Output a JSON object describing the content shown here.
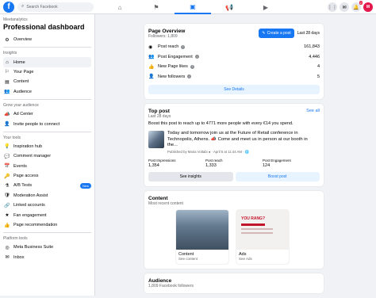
{
  "topbar": {
    "logo": "f",
    "search_placeholder": "Search Facebook",
    "nav_icons": [
      "home-icon",
      "flag-icon",
      "pages-icon",
      "megaphone-icon",
      "watch-icon"
    ],
    "right_icons": [
      "apps-grid-icon",
      "messenger-icon",
      "notifications-icon",
      "profile-avatar"
    ],
    "notification_badge": "2",
    "avatar_text": "M"
  },
  "sidebar": {
    "org": "Meetanalytics",
    "title": "Professional dashboard",
    "subtitle": "",
    "sections": [
      {
        "label": "Insights",
        "items": [
          {
            "label": "Home",
            "icon": "home-icon",
            "active": true
          },
          {
            "label": "Your Page",
            "icon": "page-icon"
          },
          {
            "label": "Content",
            "icon": "content-icon"
          },
          {
            "label": "Audience",
            "icon": "audience-icon"
          }
        ]
      },
      {
        "label": "Grow your audience",
        "items": [
          {
            "label": "Ad Center",
            "icon": "ad-center-icon"
          },
          {
            "label": "Invite people to connect",
            "icon": "invite-icon"
          }
        ]
      },
      {
        "label": "Your tools",
        "items": [
          {
            "label": "Inspiration hub",
            "icon": "inspiration-icon"
          },
          {
            "label": "Comment manager",
            "icon": "comment-icon"
          },
          {
            "label": "Events",
            "icon": "events-icon"
          },
          {
            "label": "Page access",
            "icon": "key-icon"
          },
          {
            "label": "A/B Tests",
            "icon": "ab-test-icon",
            "badge": "New"
          },
          {
            "label": "Moderation Assist",
            "icon": "moderation-icon"
          },
          {
            "label": "Linked accounts",
            "icon": "link-icon"
          },
          {
            "label": "Fan engagement",
            "icon": "fan-icon"
          },
          {
            "label": "Page recommendation",
            "icon": "recommendation-icon"
          }
        ]
      },
      {
        "label": "Platform tools",
        "items": [
          {
            "label": "Meta Business Suite",
            "icon": "business-suite-icon"
          },
          {
            "label": "Inbox",
            "icon": "inbox-icon"
          }
        ]
      }
    ],
    "overview_label": "Overview"
  },
  "overview": {
    "title": "Page Overview",
    "followers": "Followers: 1,809",
    "create_post": "Create a post",
    "range": "Last 28 days",
    "rows": [
      {
        "label": "Post reach",
        "value": "161,843",
        "icon": "reach-icon"
      },
      {
        "label": "Post Engagement",
        "value": "4,446",
        "icon": "engagement-icon"
      },
      {
        "label": "New Page likes",
        "value": "4",
        "icon": "like-icon"
      },
      {
        "label": "New followers",
        "value": "5",
        "icon": "followers-icon"
      }
    ],
    "see_details": "See Details"
  },
  "top_post": {
    "title": "Top post",
    "range": "Last 28 days",
    "see_all": "See all",
    "boost_text": "Boost this post to reach up to 4771 more people with every €14 you spend.",
    "post_text": "Today and tomorrow join us at the Future of Retail conference in Technopolis, Athens. 📣 Come and meet us in person at our booth in the...",
    "post_meta": "Published by Maria Voltabi ● · April 5 at 11:44 AM · 🌐",
    "stats": [
      {
        "label": "Post Impressions",
        "value": "1,354"
      },
      {
        "label": "Post reach",
        "value": "1,333"
      },
      {
        "label": "Post Engagement",
        "value": "124"
      }
    ],
    "see_insights": "See insights",
    "boost_post": "Boost post"
  },
  "content": {
    "title": "Content",
    "subtitle": "Most recent content",
    "tiles": [
      {
        "title": "Content",
        "sub": "See content"
      },
      {
        "title": "Ads",
        "sub": "See Ads",
        "image_text": "YOU RANG?"
      }
    ]
  },
  "audience": {
    "title": "Audience",
    "subtitle": "1,809 Facebook followers"
  }
}
